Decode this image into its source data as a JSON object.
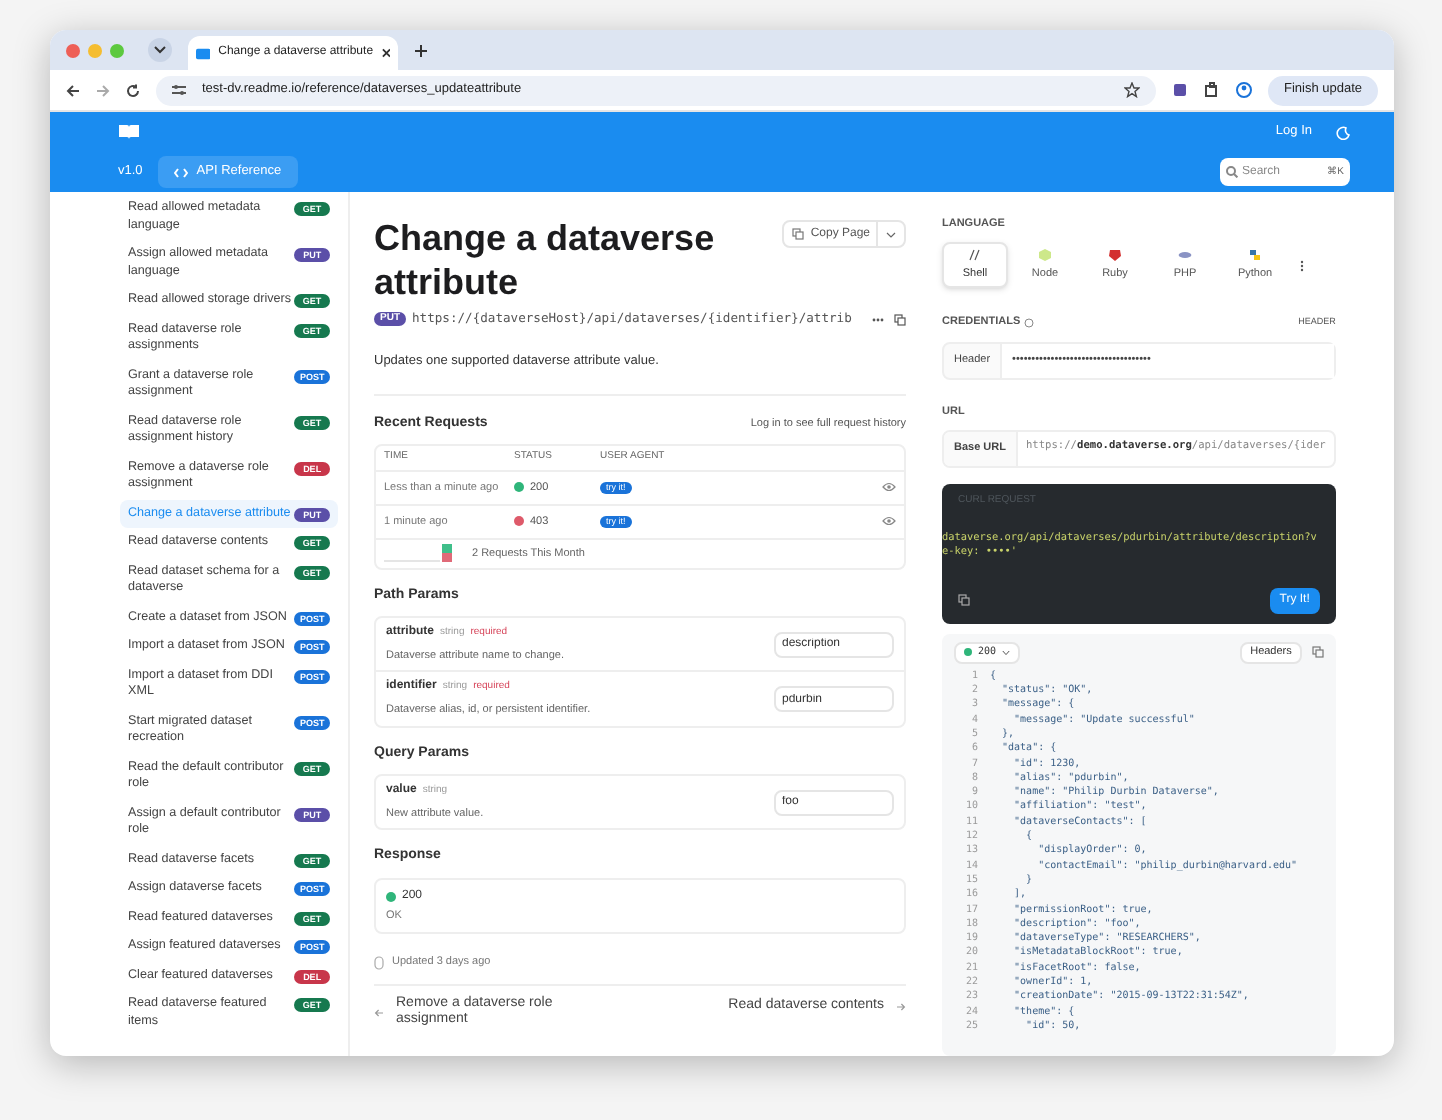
{
  "browser": {
    "tab_title": "Change a dataverse attribute",
    "url": "test-dv.readme.io/reference/dataverses_updateattribute",
    "update_button": "Finish update"
  },
  "header": {
    "login": "Log In",
    "version": "v1.0",
    "nav_label": "API Reference",
    "search": {
      "placeholder": "Search",
      "shortcut": "⌘K"
    }
  },
  "sidebar": {
    "items": [
      {
        "label": "Read allowed metadata language",
        "method": "GET",
        "color": "#16794f",
        "selected": false
      },
      {
        "label": "Assign allowed metadata language",
        "method": "PUT",
        "color": "#5b4fa8",
        "selected": false
      },
      {
        "label": "Read allowed storage drivers",
        "method": "GET",
        "color": "#16794f",
        "selected": false
      },
      {
        "label": "Read dataverse role assignments",
        "method": "GET",
        "color": "#16794f",
        "selected": false
      },
      {
        "label": "Grant a dataverse role assignment",
        "method": "POST",
        "color": "#1a73d9",
        "selected": false
      },
      {
        "label": "Read dataverse role assignment history",
        "method": "GET",
        "color": "#16794f",
        "selected": false
      },
      {
        "label": "Remove a dataverse role assignment",
        "method": "DEL",
        "color": "#c8364a",
        "selected": false
      },
      {
        "label": "Change a dataverse attribute",
        "method": "PUT",
        "color": "#5b4fa8",
        "selected": true
      },
      {
        "label": "Read dataverse contents",
        "method": "GET",
        "color": "#16794f",
        "selected": false
      },
      {
        "label": "Read dataset schema for a dataverse",
        "method": "GET",
        "color": "#16794f",
        "selected": false
      },
      {
        "label": "Create a dataset from JSON",
        "method": "POST",
        "color": "#1a73d9",
        "selected": false
      },
      {
        "label": "Import a dataset from JSON",
        "method": "POST",
        "color": "#1a73d9",
        "selected": false
      },
      {
        "label": "Import a dataset from DDI XML",
        "method": "POST",
        "color": "#1a73d9",
        "selected": false
      },
      {
        "label": "Start migrated dataset recreation",
        "method": "POST",
        "color": "#1a73d9",
        "selected": false
      },
      {
        "label": "Read the default contributor role",
        "method": "GET",
        "color": "#16794f",
        "selected": false
      },
      {
        "label": "Assign a default contributor role",
        "method": "PUT",
        "color": "#5b4fa8",
        "selected": false
      },
      {
        "label": "Read dataverse facets",
        "method": "GET",
        "color": "#16794f",
        "selected": false
      },
      {
        "label": "Assign dataverse facets",
        "method": "POST",
        "color": "#1a73d9",
        "selected": false
      },
      {
        "label": "Read featured dataverses",
        "method": "GET",
        "color": "#16794f",
        "selected": false
      },
      {
        "label": "Assign featured dataverses",
        "method": "POST",
        "color": "#1a73d9",
        "selected": false
      },
      {
        "label": "Clear featured dataverses",
        "method": "DEL",
        "color": "#c8364a",
        "selected": false
      },
      {
        "label": "Read dataverse featured items",
        "method": "GET",
        "color": "#16794f",
        "selected": false
      }
    ]
  },
  "page": {
    "title": "Change a dataverse attribute",
    "copy_button": "Copy Page",
    "method": "PUT",
    "endpoint": "https://{dataverseHost}/api/dataverses/{identifier}/attrib",
    "description": "Updates one supported dataverse attribute value.",
    "recent_requests": {
      "heading": "Recent Requests",
      "login_link": "Log in to see full request history",
      "columns": [
        "TIME",
        "STATUS",
        "USER AGENT"
      ],
      "rows": [
        {
          "time": "Less than a minute ago",
          "status": "200",
          "color": "#2fb57a",
          "agent": "try it!"
        },
        {
          "time": "1 minute ago",
          "status": "403",
          "color": "#de5a6a",
          "agent": "try it!"
        }
      ],
      "summary": "2 Requests This Month"
    },
    "path_params": {
      "heading": "Path Params",
      "params": [
        {
          "name": "attribute",
          "type": "string",
          "required": "required",
          "description": "Dataverse attribute name to change.",
          "value": "description"
        },
        {
          "name": "identifier",
          "type": "string",
          "required": "required",
          "description": "Dataverse alias, id, or persistent identifier.",
          "value": "pdurbin"
        }
      ]
    },
    "query_params": {
      "heading": "Query Params",
      "params": [
        {
          "name": "value",
          "type": "string",
          "description": "New attribute value.",
          "value": "foo"
        }
      ]
    },
    "response": {
      "heading": "Response",
      "code": "200",
      "text": "OK"
    },
    "updated": "Updated 3 days ago",
    "prev_link": "Remove a dataverse role assignment",
    "next_link": "Read dataverse contents"
  },
  "panel": {
    "language_heading": "LANGUAGE",
    "languages": [
      {
        "label": "Shell",
        "selected": true
      },
      {
        "label": "Node",
        "selected": false
      },
      {
        "label": "Ruby",
        "selected": false
      },
      {
        "label": "PHP",
        "selected": false
      },
      {
        "label": "Python",
        "selected": false
      }
    ],
    "credentials_heading": "CREDENTIALS",
    "header_toggle": "HEADER",
    "credential_label": "Header",
    "credential_value": "••••••••••••••••••••••••••••••••••••",
    "url_heading": "URL",
    "base_url_label": "Base URL",
    "base_url_prefix": "https://",
    "base_url_host": "demo.dataverse.org",
    "base_url_path": "/api/dataverses/{ider",
    "code_title": "CURL REQUEST",
    "code_lines": [
      "dataverse.org/api/dataverses/pdurbin/attribute/description?v",
      "e-key: ••••'"
    ],
    "try_button": "Try It!",
    "response_status": "200",
    "headers_button": "Headers",
    "json_lines": [
      {
        "number": "1",
        "text": "{"
      },
      {
        "number": "2",
        "text": "  \"status\": \"OK\","
      },
      {
        "number": "3",
        "text": "  \"message\": {"
      },
      {
        "number": "4",
        "text": "    \"message\": \"Update successful\""
      },
      {
        "number": "5",
        "text": "  },"
      },
      {
        "number": "6",
        "text": "  \"data\": {"
      },
      {
        "number": "7",
        "text": "    \"id\": 1230,"
      },
      {
        "number": "8",
        "text": "    \"alias\": \"pdurbin\","
      },
      {
        "number": "9",
        "text": "    \"name\": \"Philip Durbin Dataverse\","
      },
      {
        "number": "10",
        "text": "    \"affiliation\": \"test\","
      },
      {
        "number": "11",
        "text": "    \"dataverseContacts\": ["
      },
      {
        "number": "12",
        "text": "      {"
      },
      {
        "number": "13",
        "text": "        \"displayOrder\": 0,"
      },
      {
        "number": "14",
        "text": "        \"contactEmail\": \"philip_durbin@harvard.edu\""
      },
      {
        "number": "15",
        "text": "      }"
      },
      {
        "number": "16",
        "text": "    ],"
      },
      {
        "number": "17",
        "text": "    \"permissionRoot\": true,"
      },
      {
        "number": "18",
        "text": "    \"description\": \"foo\","
      },
      {
        "number": "19",
        "text": "    \"dataverseType\": \"RESEARCHERS\","
      },
      {
        "number": "20",
        "text": "    \"isMetadataBlockRoot\": true,"
      },
      {
        "number": "21",
        "text": "    \"isFacetRoot\": false,"
      },
      {
        "number": "22",
        "text": "    \"ownerId\": 1,"
      },
      {
        "number": "23",
        "text": "    \"creationDate\": \"2015-09-13T22:31:54Z\","
      },
      {
        "number": "24",
        "text": "    \"theme\": {"
      },
      {
        "number": "25",
        "text": "      \"id\": 50,"
      }
    ]
  }
}
